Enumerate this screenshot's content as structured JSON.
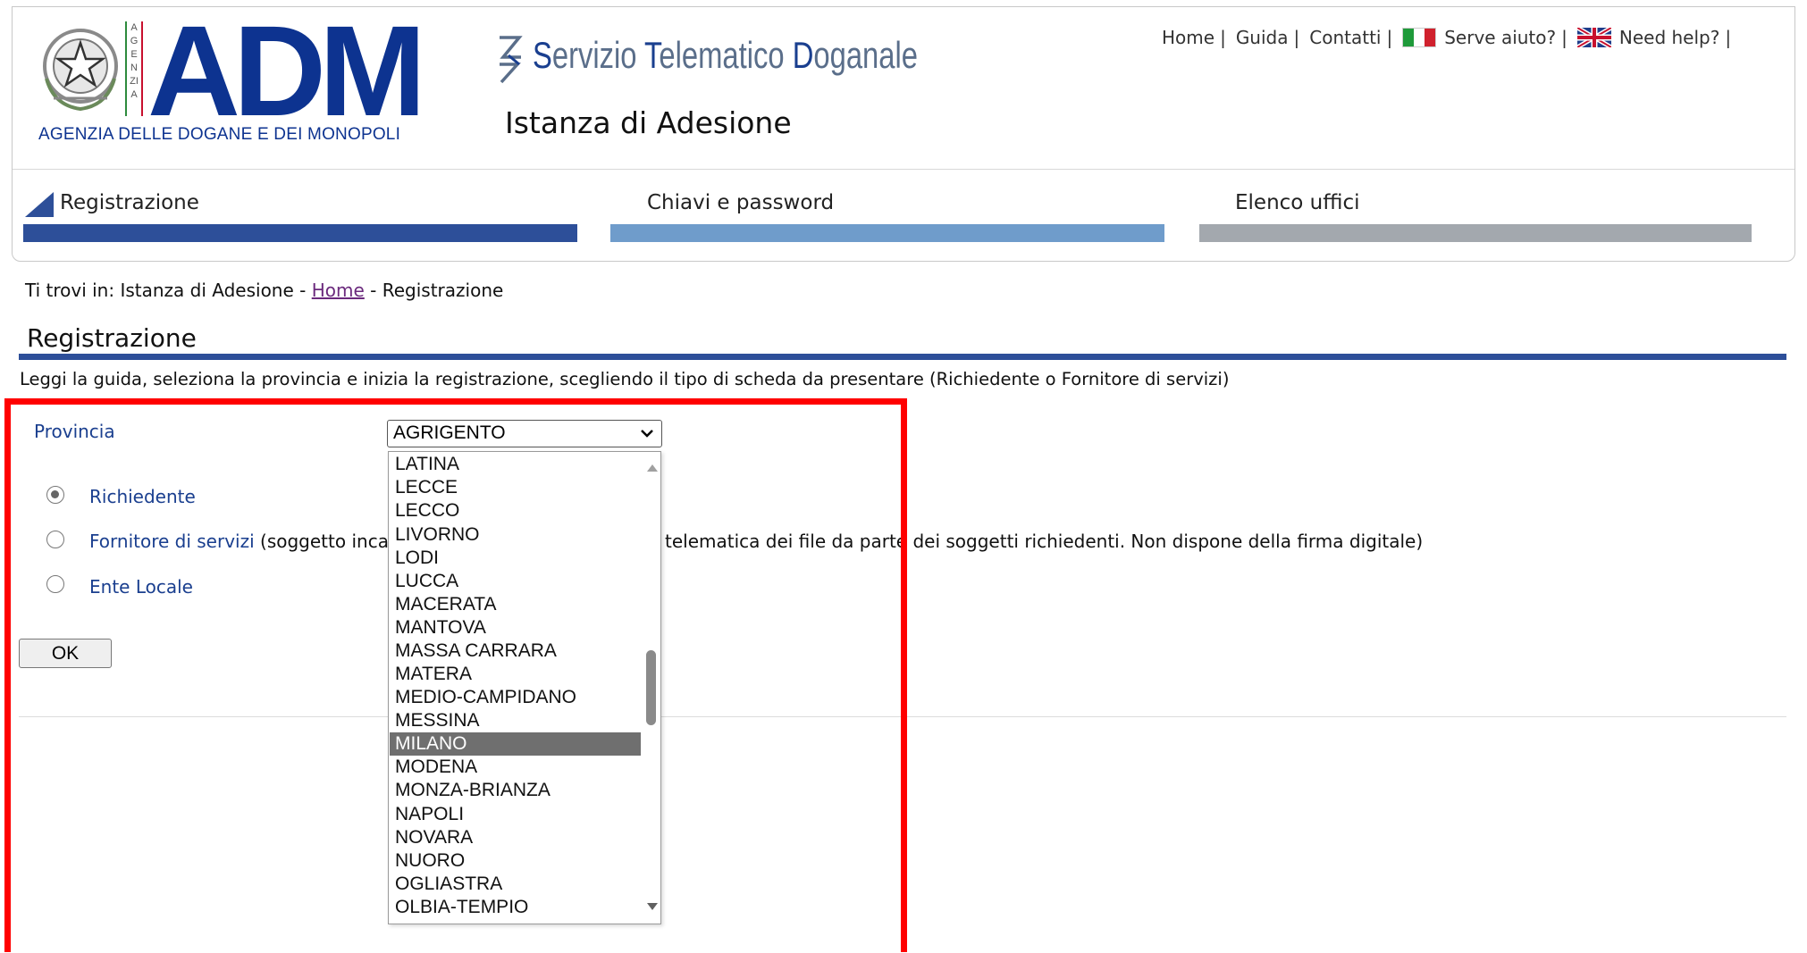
{
  "header": {
    "logo_text": "ADM",
    "logo_vertical": "AGENZIA",
    "logo_subtitle": "AGENZIA DELLE DOGANE E DEI MONOPOLI",
    "service_title_parts": [
      "S",
      "ervizio ",
      "T",
      "elematico ",
      "D",
      "oganale"
    ],
    "page_title": "Istanza di Adesione",
    "top_links": {
      "home": "Home",
      "guida": "Guida",
      "contatti": "Contatti",
      "serve_aiuto": "Serve aiuto?",
      "need_help": "Need help?",
      "separator": "|"
    }
  },
  "steps": [
    {
      "label": "Registrazione",
      "color": "#2d4f99",
      "active": true
    },
    {
      "label": "Chiavi e password",
      "color": "#6f9ccb",
      "active": false
    },
    {
      "label": "Elenco uffici",
      "color": "#a3a8ae",
      "active": false
    }
  ],
  "breadcrumb": {
    "prefix": "Ti trovi in: Istanza di Adesione - ",
    "home_link": "Home",
    "suffix": " - Registrazione"
  },
  "section": {
    "title": "Registrazione",
    "instructions": "Leggi la guida, seleziona la provincia e inizia la registrazione, scegliendo il tipo di scheda da presentare (Richiedente o Fornitore di servizi)"
  },
  "form": {
    "provincia_label": "Provincia",
    "provincia_selected": "AGRIGENTO",
    "radio_options": [
      {
        "label": "Richiedente",
        "checked": true
      },
      {
        "label": "Fornitore di servizi",
        "description_left": " (soggetto inca",
        "description_right": "telematica dei file da parte dei soggetti richiedenti. Non dispone della firma digitale)",
        "checked": false
      },
      {
        "label": "Ente Locale",
        "checked": false
      }
    ],
    "ok_label": "OK"
  },
  "dropdown": {
    "options": [
      "LATINA",
      "LECCE",
      "LECCO",
      "LIVORNO",
      "LODI",
      "LUCCA",
      "MACERATA",
      "MANTOVA",
      "MASSA CARRARA",
      "MATERA",
      "MEDIO-CAMPIDANO",
      "MESSINA",
      "MILANO",
      "MODENA",
      "MONZA-BRIANZA",
      "NAPOLI",
      "NOVARA",
      "NUORO",
      "OGLIASTRA",
      "OLBIA-TEMPIO"
    ],
    "highlighted": "MILANO"
  },
  "colors": {
    "brand_blue": "#0d3390",
    "accent_blue": "#2d4f99",
    "link_blue": "#1a3f8f",
    "highlight_red": "#ff0000"
  }
}
